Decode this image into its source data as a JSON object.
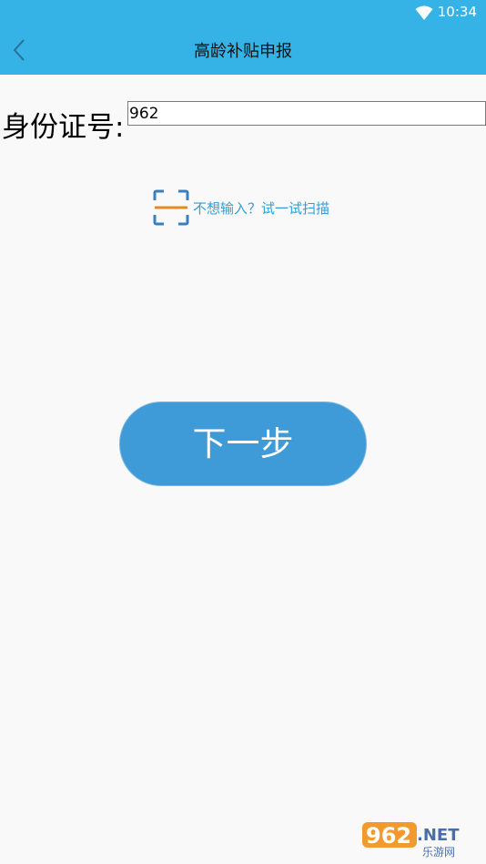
{
  "status_bar": {
    "time": "10:34",
    "wifi_icon": "wifi-icon"
  },
  "app_bar": {
    "title": "高龄补贴申报",
    "back_icon": "chevron-left-icon"
  },
  "form": {
    "id_label": "身份证号:",
    "id_value": "962"
  },
  "scan": {
    "icon": "scan-icon",
    "text": "不想输入？试一试扫描"
  },
  "next_button": {
    "label": "下一步"
  },
  "watermark": {
    "brand": "962.NET",
    "sub": "乐游网"
  },
  "colors": {
    "header": "#35b3e6",
    "button": "#3f9bd8",
    "link": "#2f9fd8",
    "scan_line": "#e88a1f"
  }
}
